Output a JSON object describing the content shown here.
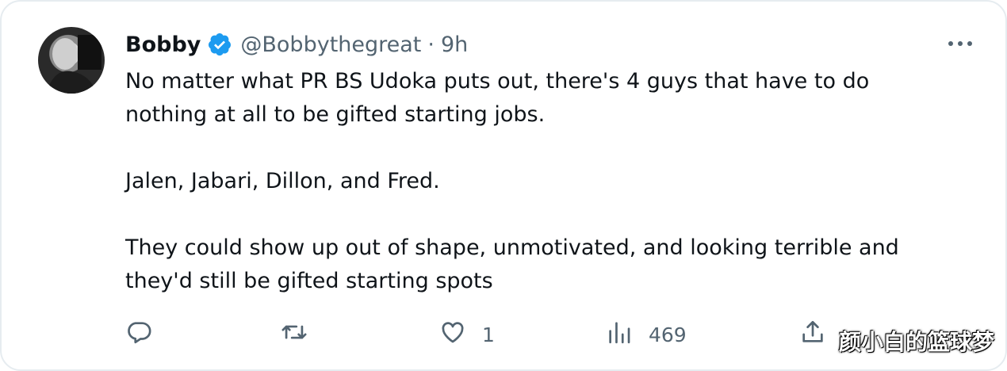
{
  "tweet": {
    "author_name": "Bobby",
    "handle": "@Bobbythegreat",
    "separator": "·",
    "time": "9h",
    "text_lines": [
      "No matter what PR BS Udoka puts out, there's 4 guys that have to do",
      "nothing at all to be gifted starting jobs.",
      "Jalen, Jabari, Dillon, and Fred.",
      "They could show up out of shape, unmotivated, and looking terrible and",
      "they'd still be gifted starting spots"
    ]
  },
  "actions": {
    "reply_icon": "reply-icon",
    "retweet_icon": "retweet-icon",
    "like_icon": "heart-icon",
    "like_count": "1",
    "views_icon": "views-icon",
    "views_count": "469",
    "share_icon": "share-icon"
  },
  "watermark": "颜小白的篮球梦",
  "colors": {
    "verified": "#1d9bf0",
    "secondary_text": "#536471",
    "primary_text": "#0f1419"
  }
}
